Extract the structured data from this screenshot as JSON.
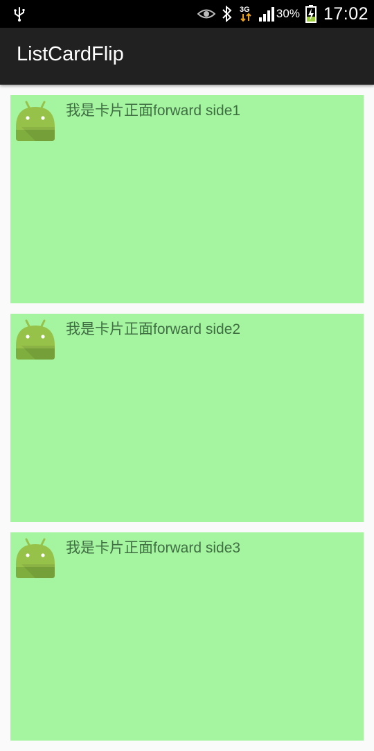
{
  "status_bar": {
    "icons": [
      "usb-icon",
      "eye-icon",
      "bluetooth-icon",
      "3g-data-icon",
      "signal-icon",
      "battery-charging-icon"
    ],
    "network_type": "3G",
    "battery_percent": "30%",
    "time": "17:02"
  },
  "app_bar": {
    "title": "ListCardFlip"
  },
  "cards": [
    {
      "text": "我是卡片正面forward side1",
      "icon": "android-robot-icon"
    },
    {
      "text": "我是卡片正面forward side2",
      "icon": "android-robot-icon"
    },
    {
      "text": "我是卡片正面forward side3",
      "icon": "android-robot-icon"
    }
  ],
  "colors": {
    "card_background": "#a4f4a0",
    "card_text": "#3f6e42",
    "app_bar": "#212121",
    "status_bar": "#000000",
    "android_green": "#97c24a"
  }
}
